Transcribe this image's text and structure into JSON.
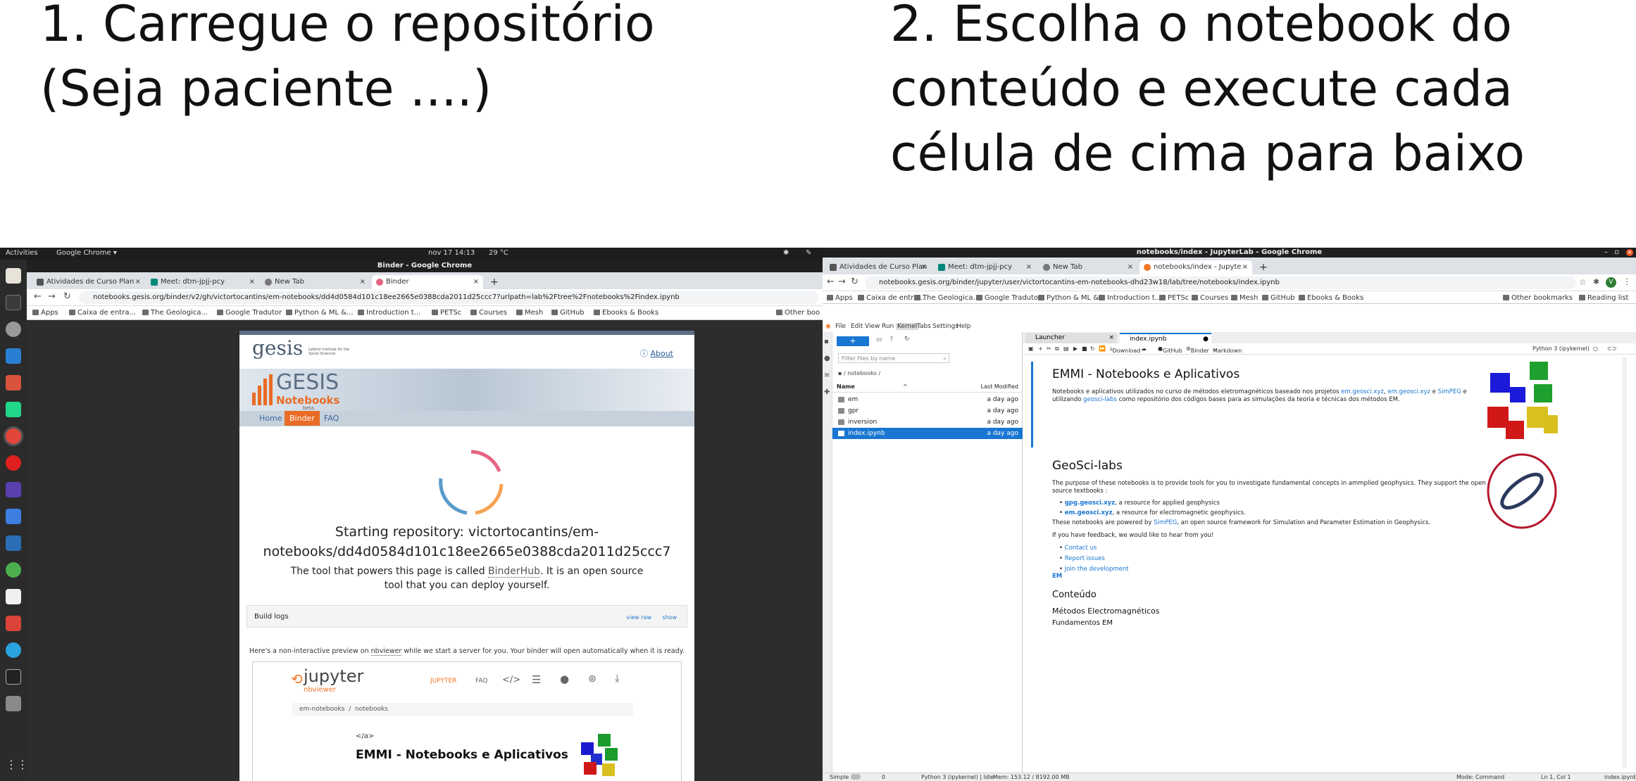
{
  "captions": {
    "step1": "1. Carregue o repositório\n(Seja paciente ....)",
    "step2": "2. Escolha o notebook do\nconteúdo e execute cada\ncélula de cima para baixo"
  },
  "left": {
    "ubuntu": {
      "activities": "Activities",
      "app": "Google Chrome ▾",
      "clock": "nov 17  14:13",
      "weather": "29 °C"
    },
    "window_title": "Binder - Google Chrome",
    "tabs": [
      {
        "label": "Atividades de Curso Plan"
      },
      {
        "label": "Meet: dtm-jpjj-pcy"
      },
      {
        "label": "New Tab"
      },
      {
        "label": "Binder"
      }
    ],
    "url": "notebooks.gesis.org/binder/v2/gh/victortocantins/em-notebooks/dd4d0584d101c18ee2665e0388cda2011d25ccc7?urlpath=lab%2Ftree%2Fnotebooks%2Findex.ipynb",
    "bookmarks": [
      "Apps",
      "Caixa de entra...",
      "The Geologica...",
      "Google Tradutor",
      "Python & ML &...",
      "Introduction t...",
      "PETSc",
      "Courses",
      "Mesh",
      "GitHub",
      "Ebooks & Books",
      "Other boo"
    ],
    "binder": {
      "about": "About",
      "logo_text": "gesis",
      "logo_sub": "Leibniz Institute for the Social Sciences",
      "brand": "GESIS",
      "brand_sub": "Notebooks",
      "brand_beta": "beta",
      "nav": [
        "Home",
        "Binder",
        "FAQ"
      ],
      "starting_line1": "Starting repository: victortocantins/em-",
      "starting_line2": "notebooks/dd4d0584d101c18ee2665e0388cda2011d25ccc7",
      "tool_line1_a": "The tool that powers this page is called ",
      "tool_link": "BinderHub",
      "tool_line1_b": ". It is an open source",
      "tool_line2": "tool that you can deploy yourself.",
      "build_logs": "Build logs",
      "view_raw": "view raw",
      "show": "show",
      "preview_a": "Here's a non-interactive preview on ",
      "preview_link": "nbviewer",
      "preview_b": " while we start a server for you. Your binder will open automatically when it is ready.",
      "nbviewer": {
        "brand": "jupyter",
        "brand_sub": "nbviewer",
        "nav_jupyter": "JUPYTER",
        "nav_faq": "FAQ",
        "breadcrumb": [
          "em-notebooks",
          "notebooks"
        ],
        "tag": "</a>",
        "heading": "EMMI - Notebooks e Aplicativos"
      }
    }
  },
  "right": {
    "window_title": "notebooks/index - JupyterLab - Google Chrome",
    "tabs": [
      {
        "label": "Atividades de Curso Plan"
      },
      {
        "label": "Meet: dtm-jpjj-pcy"
      },
      {
        "label": "New Tab"
      },
      {
        "label": "notebooks/index - Jupyte"
      }
    ],
    "url": "notebooks.gesis.org/binder/jupyter/user/victortocantins-em-notebooks-dhd23w18/lab/tree/notebooks/index.ipynb",
    "bookmarks": [
      "Apps",
      "Caixa de entra...",
      "The Geologica...",
      "Google Tradutor",
      "Python & ML &...",
      "Introduction t...",
      "PETSc",
      "Courses",
      "Mesh",
      "GitHub",
      "Ebooks & Books",
      "Other bookmarks",
      "Reading list"
    ],
    "menu": [
      "File",
      "Edit",
      "View",
      "Run",
      "Kernel",
      "Tabs",
      "Settings",
      "Help"
    ],
    "filebrowser": {
      "filter_placeholder": "Filter files by name",
      "path": "/ notebooks /",
      "col_name": "Name",
      "col_modified": "Last Modified",
      "files": [
        {
          "name": "em",
          "modified": "a day ago"
        },
        {
          "name": "gpr",
          "modified": "a day ago"
        },
        {
          "name": "inversion",
          "modified": "a day ago"
        },
        {
          "name": "index.ipynb",
          "modified": "a day ago"
        }
      ]
    },
    "doc_tabs": [
      "Launcher",
      "index.ipynb"
    ],
    "toolbar": {
      "download": "Download",
      "github": "GitHub",
      "binder": "Binder",
      "celltype": "Markdown",
      "kernel": "Python 3 (ipykernel)"
    },
    "notebook": {
      "title": "EMMI - Notebooks e Aplicativos",
      "intro_a": "Notebooks e aplicativos utilizados no curso de métodos eletromagnéticos baseado nos projetos ",
      "intro_l1": "em.geosci.xyz",
      "intro_l2": "em.geosci.xyz",
      "intro_b": " e ",
      "intro_l3": "SimPEG",
      "intro_c": " e utilizando ",
      "intro_l4": "geosci-labs",
      "intro_d": " como repositório dos códigos bases para as simulações da teoria e técnicas dos métodos EM.",
      "h2": "GeoSci-labs",
      "purpose": "The purpose of these notebooks is to provide tools for you to investigate fundamental concepts in ammplied geophysics. They support the open source textbooks :",
      "bullets": [
        {
          "link": "gpg.geosci.xyz",
          "text": ", a resource for applied geophysics"
        },
        {
          "link": "em.geosci.xyz",
          "text": ", a resource for electromagnetic geophysics."
        }
      ],
      "powered_a": "These notebooks are powered by ",
      "powered_link": "SimPEG",
      "powered_b": ", an open source framework for Simulation and Parameter Estimation in Geophysics.",
      "feedback": "If you have feedback, we would like to hear from you!",
      "links": [
        "Contact us",
        "Report issues",
        "Join the development"
      ],
      "em": "EM",
      "h3": "Conteúdo",
      "h4": "Métodos Electromagnéticos",
      "h5": "Fundamentos EM"
    },
    "status": {
      "mode": "Simple",
      "counts": "0",
      "kernel": "Python 3 (ipykernel) | Idle",
      "mem": "Mem: 153.12 / 8192.00 MB",
      "cmd": "Mode: Command",
      "pos": "Ln 1, Col 1",
      "file": "index.ipynb"
    }
  }
}
